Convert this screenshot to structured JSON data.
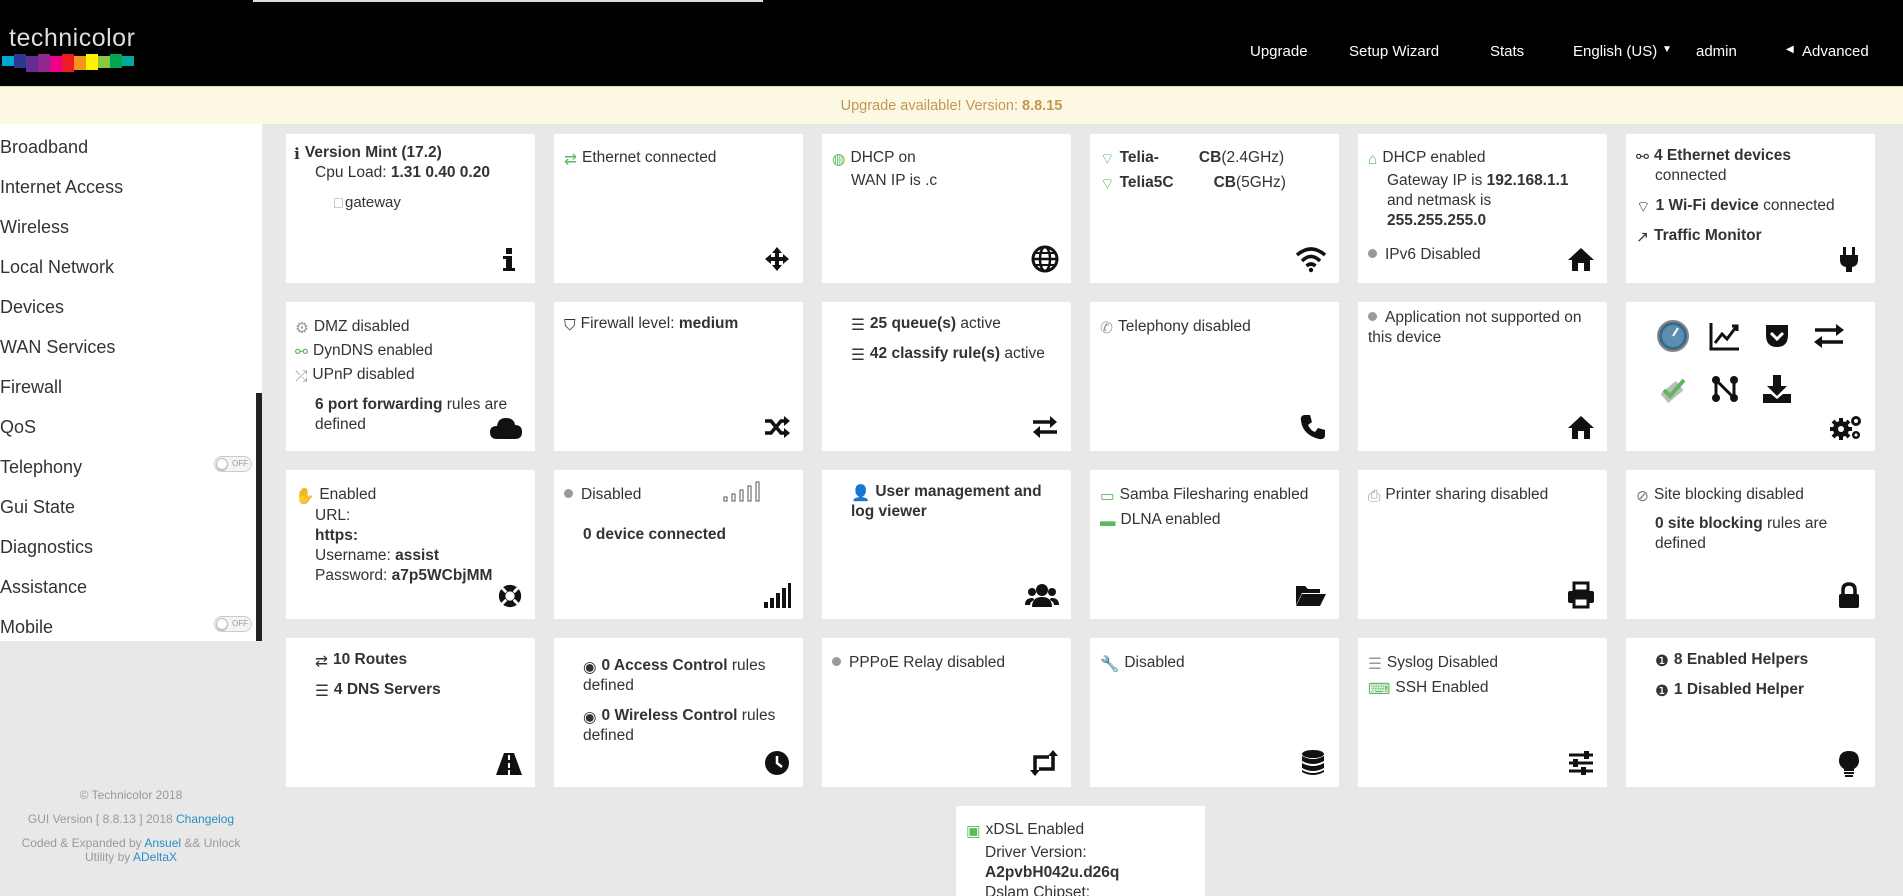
{
  "header": {
    "logo": "technicolor",
    "nav": {
      "upgrade": "Upgrade",
      "wizard": "Setup Wizard",
      "stats": "Stats",
      "lang": "English (US)",
      "user": "admin",
      "advanced": "Advanced"
    }
  },
  "banner": {
    "text": "Upgrade available! Version: ",
    "version": "8.8.15"
  },
  "sidebar": {
    "items": [
      "Broadband",
      "Internet Access",
      "Wireless",
      "Local Network",
      "Devices",
      "WAN Services",
      "Firewall",
      "QoS",
      "Telephony",
      "Gui State",
      "Diagnostics",
      "Assistance",
      "Mobile"
    ],
    "toggle_off": "OFF"
  },
  "footer": {
    "copyright": "© Technicolor 2018",
    "gui_version": "GUI Version [ 8.8.13 ] 2018",
    "changelog": "Changelog",
    "coded": "Coded & Expanded by",
    "ansuel": "Ansuel",
    "unlock": "&& Unlock",
    "utility": "Utility by",
    "adeltax": "ADeltaX"
  },
  "cards": {
    "gateway": {
      "version": "Version Mint (17.2)",
      "cpu_label": "Cpu Load: ",
      "cpu": "1.31 0.40 0.20",
      "img_alt": "gateway"
    },
    "broadband": {
      "status": "Ethernet connected"
    },
    "internet": {
      "dhcp": "DHCP on",
      "wan": "WAN IP is ",
      "wan_ip": ".c"
    },
    "wireless": {
      "ssid1": "Telia-",
      "ssid1b": "CB",
      "band1": "(2.4GHz)",
      "ssid2": "Telia5C",
      "ssid2b": "CB",
      "band2": "(5GHz)"
    },
    "local": {
      "dhcp": "DHCP enabled",
      "gw_label": "Gateway IP is ",
      "gw": "192.168.1.1",
      "and_netmask": "and netmask is",
      "netmask": "255.255.255.0",
      "ipv6": "IPv6 Disabled"
    },
    "devices": {
      "eth_b": "4 Ethernet devices",
      "eth_t": "connected",
      "wifi_b": "1 Wi-Fi device",
      "wifi_t": " connected",
      "traffic": "Traffic Monitor"
    },
    "wan_services": {
      "dmz": "DMZ disabled",
      "dyndns": "DynDNS enabled",
      "upnp": "UPnP disabled",
      "pf_b": "6 port forwarding",
      "pf_t": " rules are",
      "pf_t2": "defined"
    },
    "firewall": {
      "label": "Firewall level: ",
      "level": "medium"
    },
    "qos": {
      "queues_b": "25 queue(s)",
      "queues_t": " active",
      "classify_b": "42 classify rule(s)",
      "classify_t": " active"
    },
    "telephony": {
      "status": "Telephony disabled"
    },
    "gui_state": {
      "line1": "Application not supported on",
      "line2": "this device"
    },
    "assistance": {
      "status": "Enabled",
      "url_label": "URL:",
      "url": "https:",
      "user_label": "Username: ",
      "user": "assist",
      "pass_label": "Password: ",
      "pass": "a7p5WCbjMM"
    },
    "mobile": {
      "status": "Disabled",
      "devices": "0 device connected"
    },
    "users": {
      "line1": "User management and",
      "line2": "log viewer"
    },
    "content": {
      "samba": "Samba Filesharing enabled",
      "dlna": "DLNA enabled"
    },
    "printer": {
      "status": "Printer sharing disabled"
    },
    "parental": {
      "status": "Site blocking disabled",
      "rules_b": "0 site blocking",
      "rules_t": " rules are",
      "rules_t2": "defined"
    },
    "routes": {
      "routes": "10 Routes",
      "dns": "4 DNS Servers"
    },
    "tod": {
      "ac_b": "0 Access Control",
      "ac_t": " rules",
      "ac_t2": "defined",
      "wc_b": "0 Wireless Control",
      "wc_t": " rules",
      "wc_t2": "defined"
    },
    "relay": {
      "status": "PPPoE Relay disabled"
    },
    "iptv": {
      "status": "Disabled"
    },
    "system": {
      "syslog": "Syslog Disabled",
      "ssh": "SSH Enabled"
    },
    "helpers": {
      "enabled": "8 Enabled Helpers",
      "disabled": "1 Disabled Helper"
    },
    "xdsl": {
      "status": "xDSL Enabled",
      "driver_label": "Driver Version:",
      "driver": "A2pvbH042u.d26q",
      "dslam_label": "Dslam Chipset:"
    }
  },
  "colors": {
    "accent": "#5cb85c",
    "link": "#2a8ec4",
    "banner_text": "#c09853"
  }
}
